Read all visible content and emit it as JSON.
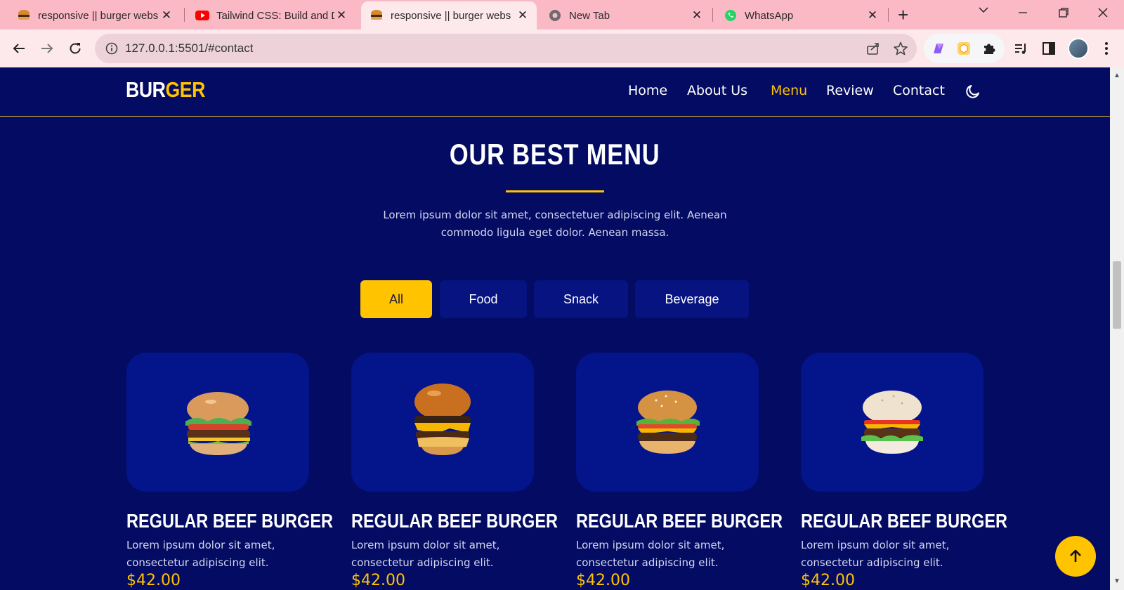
{
  "browser": {
    "tabs": [
      {
        "title": "responsive || burger webs",
        "icon": "burger-favicon"
      },
      {
        "title": "Tailwind CSS: Build and De",
        "icon": "youtube-favicon"
      },
      {
        "title": "responsive || burger webs",
        "icon": "burger-favicon"
      },
      {
        "title": "New Tab",
        "icon": "chrome-favicon"
      },
      {
        "title": "WhatsApp",
        "icon": "whatsapp-favicon"
      }
    ],
    "close_glyph": "✕",
    "new_tab_glyph": "+",
    "url": "127.0.0.1:5501/#contact"
  },
  "site": {
    "logo_part1": "BUR",
    "logo_part2": "GER",
    "nav": [
      "Home",
      "About Us",
      "Menu",
      "Review",
      "Contact"
    ],
    "active_nav": "Menu",
    "section_title": "OUR BEST MENU",
    "section_desc": "Lorem ipsum dolor sit amet, consectetuer adipiscing elit. Aenean commodo ligula eget dolor. Aenean massa.",
    "filters": [
      "All",
      "Food",
      "Snack",
      "Beverage"
    ],
    "active_filter": "All",
    "cards": [
      {
        "name": "REGULAR BEEF BURGER",
        "desc": "Lorem ipsum dolor sit amet, consectetur adipiscing elit.",
        "price": "$42.00"
      },
      {
        "name": "REGULAR BEEF BURGER",
        "desc": "Lorem ipsum dolor sit amet, consectetur adipiscing elit.",
        "price": "$42.00"
      },
      {
        "name": "REGULAR BEEF BURGER",
        "desc": "Lorem ipsum dolor sit amet, consectetur adipiscing elit.",
        "price": "$42.00"
      },
      {
        "name": "REGULAR BEEF BURGER",
        "desc": "Lorem ipsum dolor sit amet, consectetur adipiscing elit.",
        "price": "$42.00"
      }
    ]
  },
  "colors": {
    "page_bg": "#030b62",
    "accent": "#ffc300",
    "card_bg": "#04148a",
    "filter_bg": "#061380",
    "browser_frame": "#fbb9c6"
  }
}
